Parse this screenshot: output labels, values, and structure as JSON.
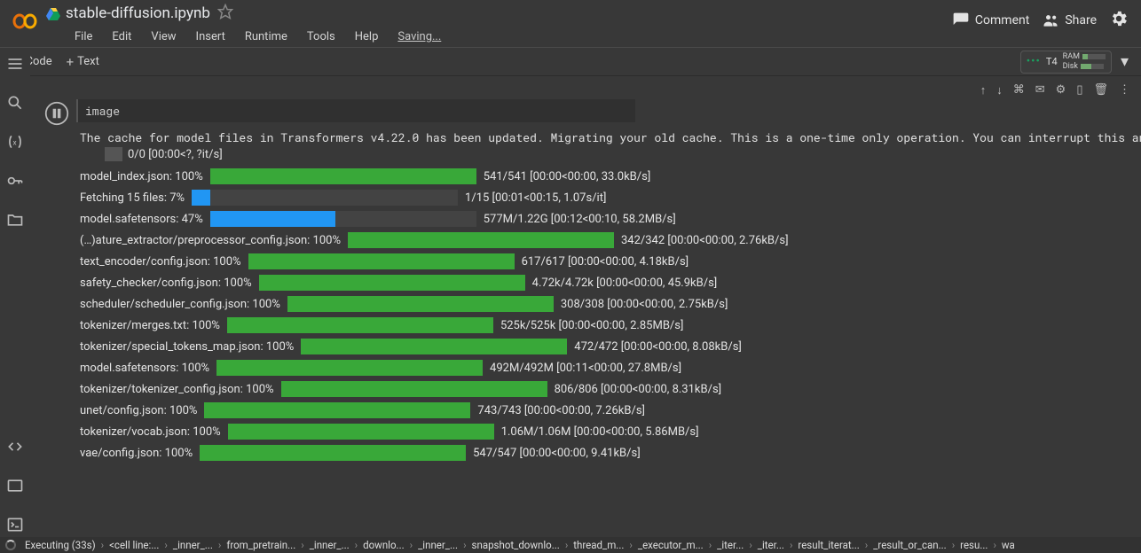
{
  "header": {
    "title": "stable-diffusion.ipynb",
    "menu": [
      "File",
      "Edit",
      "View",
      "Insert",
      "Runtime",
      "Tools",
      "Help"
    ],
    "saving": "Saving...",
    "comment": "Comment",
    "share": "Share"
  },
  "toolbar": {
    "code": "Code",
    "text": "Text",
    "runtime_label": "T4",
    "ram_label": "RAM",
    "disk_label": "Disk"
  },
  "cell": {
    "input": "image",
    "cache_msg": "The cache for model files in Transformers v4.22.0 has been updated. Migrating your old cache. This is a one-time only operation. You can interrupt this and",
    "zero_stats": "0/0 [00:00<?, ?it/s]",
    "progress": [
      {
        "label": "model_index.json: 100%",
        "pct": 100,
        "color": "green",
        "stats": "541/541 [00:00<00:00, 33.0kB/s]"
      },
      {
        "label": "Fetching 15 files: 7%",
        "pct": 7,
        "color": "blue",
        "stats": "1/15 [00:01<00:15, 1.07s/it]"
      },
      {
        "label": "model.safetensors: 47%",
        "pct": 47,
        "color": "blue",
        "stats": "577M/1.22G [00:12<00:10, 58.2MB/s]"
      },
      {
        "label": "(…)ature_extractor/preprocessor_config.json: 100%",
        "pct": 100,
        "color": "green",
        "stats": "342/342 [00:00<00:00, 2.76kB/s]"
      },
      {
        "label": "text_encoder/config.json: 100%",
        "pct": 100,
        "color": "green",
        "stats": "617/617 [00:00<00:00, 4.18kB/s]"
      },
      {
        "label": "safety_checker/config.json: 100%",
        "pct": 100,
        "color": "green",
        "stats": "4.72k/4.72k [00:00<00:00, 45.9kB/s]"
      },
      {
        "label": "scheduler/scheduler_config.json: 100%",
        "pct": 100,
        "color": "green",
        "stats": "308/308 [00:00<00:00, 2.75kB/s]"
      },
      {
        "label": "tokenizer/merges.txt: 100%",
        "pct": 100,
        "color": "green",
        "stats": "525k/525k [00:00<00:00, 2.85MB/s]"
      },
      {
        "label": "tokenizer/special_tokens_map.json: 100%",
        "pct": 100,
        "color": "green",
        "stats": "472/472 [00:00<00:00, 8.08kB/s]"
      },
      {
        "label": "model.safetensors: 100%",
        "pct": 100,
        "color": "green",
        "stats": "492M/492M [00:11<00:00, 27.8MB/s]"
      },
      {
        "label": "tokenizer/tokenizer_config.json: 100%",
        "pct": 100,
        "color": "green",
        "stats": "806/806 [00:00<00:00, 8.31kB/s]"
      },
      {
        "label": "unet/config.json: 100%",
        "pct": 100,
        "color": "green",
        "stats": "743/743 [00:00<00:00, 7.26kB/s]"
      },
      {
        "label": "tokenizer/vocab.json: 100%",
        "pct": 100,
        "color": "green",
        "stats": "1.06M/1.06M [00:00<00:00, 5.86MB/s]"
      },
      {
        "label": "vae/config.json: 100%",
        "pct": 100,
        "color": "green",
        "stats": "547/547 [00:00<00:00, 9.41kB/s]"
      }
    ]
  },
  "status": {
    "executing": "Executing (33s)",
    "frames": [
      "<cell line:...",
      "_inner_...",
      "from_pretrain...",
      "_inner_...",
      "downlo...",
      "_inner_...",
      "snapshot_downlo...",
      "thread_m...",
      "_executor_m...",
      "_iter...",
      "_iter...",
      "result_iterat...",
      "_result_or_can...",
      "resu...",
      "wa"
    ]
  }
}
